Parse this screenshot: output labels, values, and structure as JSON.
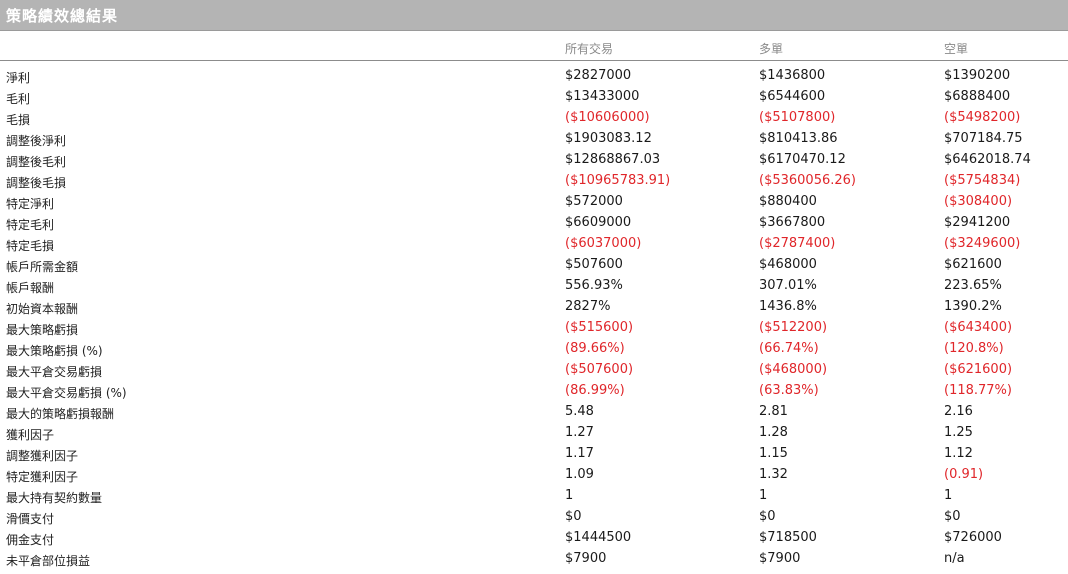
{
  "title": "策略績效總結果",
  "columns": [
    "所有交易",
    "多單",
    "空單"
  ],
  "rows": [
    {
      "label": "淨利",
      "values": [
        "$2827000",
        "$1436800",
        "$1390200"
      ]
    },
    {
      "label": "毛利",
      "values": [
        "$13433000",
        "$6544600",
        "$6888400"
      ]
    },
    {
      "label": "毛損",
      "values": [
        "($10606000)",
        "($5107800)",
        "($5498200)"
      ]
    },
    {
      "label": "調整後淨利",
      "values": [
        "$1903083.12",
        "$810413.86",
        "$707184.75"
      ]
    },
    {
      "label": "調整後毛利",
      "values": [
        "$12868867.03",
        "$6170470.12",
        "$6462018.74"
      ]
    },
    {
      "label": "調整後毛損",
      "values": [
        "($10965783.91)",
        "($5360056.26)",
        "($5754834)"
      ]
    },
    {
      "label": "特定淨利",
      "values": [
        "$572000",
        "$880400",
        "($308400)"
      ]
    },
    {
      "label": "特定毛利",
      "values": [
        "$6609000",
        "$3667800",
        "$2941200"
      ]
    },
    {
      "label": "特定毛損",
      "values": [
        "($6037000)",
        "($2787400)",
        "($3249600)"
      ]
    },
    {
      "label": "帳戶所需金額",
      "values": [
        "$507600",
        "$468000",
        "$621600"
      ]
    },
    {
      "label": "帳戶報酬",
      "values": [
        "556.93%",
        "307.01%",
        "223.65%"
      ]
    },
    {
      "label": "初始資本報酬",
      "values": [
        "2827%",
        "1436.8%",
        "1390.2%"
      ]
    },
    {
      "label": "最大策略虧損",
      "values": [
        "($515600)",
        "($512200)",
        "($643400)"
      ]
    },
    {
      "label": "最大策略虧損 (%)",
      "values": [
        "(89.66%)",
        "(66.74%)",
        "(120.8%)"
      ]
    },
    {
      "label": "最大平倉交易虧損",
      "values": [
        "($507600)",
        "($468000)",
        "($621600)"
      ]
    },
    {
      "label": "最大平倉交易虧損 (%)",
      "values": [
        "(86.99%)",
        "(63.83%)",
        "(118.77%)"
      ]
    },
    {
      "label": "最大的策略虧損報酬",
      "values": [
        "5.48",
        "2.81",
        "2.16"
      ]
    },
    {
      "label": "獲利因子",
      "values": [
        "1.27",
        "1.28",
        "1.25"
      ]
    },
    {
      "label": "調整獲利因子",
      "values": [
        "1.17",
        "1.15",
        "1.12"
      ]
    },
    {
      "label": "特定獲利因子",
      "values": [
        "1.09",
        "1.32",
        "(0.91)"
      ]
    },
    {
      "label": "最大持有契約數量",
      "values": [
        "1",
        "1",
        "1"
      ]
    },
    {
      "label": "滑價支付",
      "values": [
        "$0",
        "$0",
        "$0"
      ]
    },
    {
      "label": "佣金支付",
      "values": [
        "$1444500",
        "$718500",
        "$726000"
      ]
    },
    {
      "label": "未平倉部位損益",
      "values": [
        "$7900",
        "$7900",
        "n/a"
      ]
    }
  ],
  "colors": {
    "negative": "#e0262a",
    "titlebar": "#b4b4b4",
    "header_text": "#8a8a8a"
  }
}
